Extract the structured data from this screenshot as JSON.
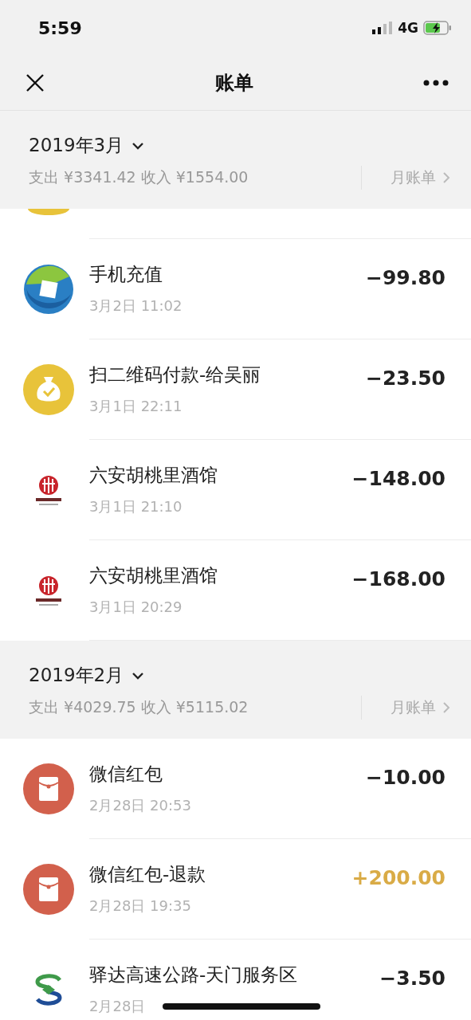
{
  "status_bar": {
    "time": "5:59",
    "network": "4G"
  },
  "nav": {
    "title": "账单"
  },
  "months": [
    {
      "month": "2019年3月",
      "summary": "支出 ¥3341.42 收入 ¥1554.00",
      "link": "月账单",
      "peek": {
        "kind": "coin"
      },
      "items": [
        {
          "kind": "phone",
          "title": "手机充值",
          "date": "3月2日 11:02",
          "amount": "−99.80",
          "income": false
        },
        {
          "kind": "coin",
          "title": "扫二维码付款-给吴丽",
          "date": "3月1日 22:11",
          "amount": "−23.50",
          "income": false
        },
        {
          "kind": "citic",
          "title": "六安胡桃里酒馆",
          "date": "3月1日 21:10",
          "amount": "−148.00",
          "income": false
        },
        {
          "kind": "citic",
          "title": "六安胡桃里酒馆",
          "date": "3月1日 20:29",
          "amount": "−168.00",
          "income": false
        }
      ]
    },
    {
      "month": "2019年2月",
      "summary": "支出 ¥4029.75 收入 ¥5115.02",
      "link": "月账单",
      "items": [
        {
          "kind": "packet",
          "title": "微信红包",
          "date": "2月28日 20:53",
          "amount": "−10.00",
          "income": false
        },
        {
          "kind": "packet",
          "title": "微信红包-退款",
          "date": "2月28日 19:35",
          "amount": "+200.00",
          "income": true
        },
        {
          "kind": "spdb",
          "title": "驿达高速公路-天门服务区",
          "date": "2月28日",
          "amount": "−3.50",
          "income": false
        }
      ]
    }
  ]
}
